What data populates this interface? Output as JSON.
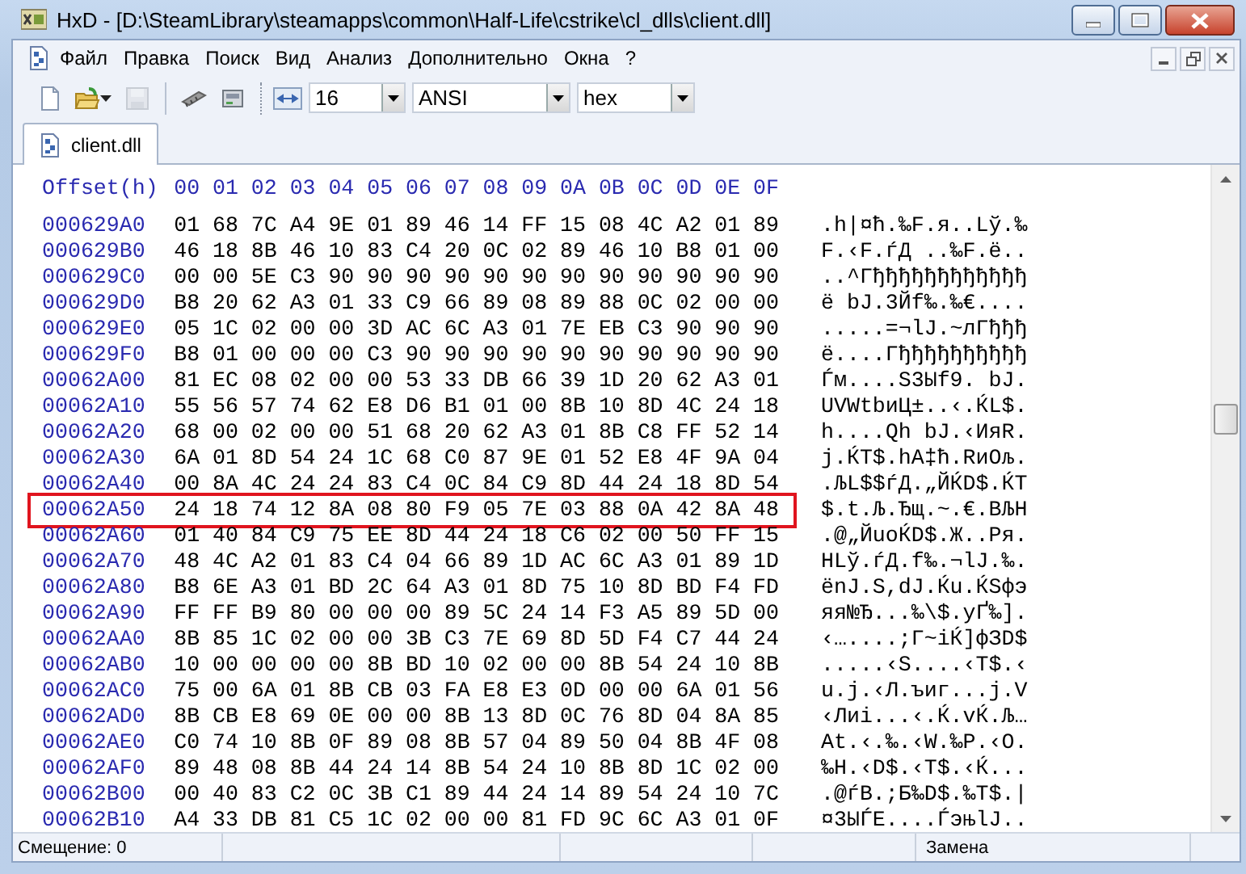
{
  "window": {
    "title": "HxD - [D:\\SteamLibrary\\steamapps\\common\\Half-Life\\cstrike\\cl_dlls\\client.dll]"
  },
  "menu": [
    {
      "label": "Файл"
    },
    {
      "label": "Правка"
    },
    {
      "label": "Поиск"
    },
    {
      "label": "Вид"
    },
    {
      "label": "Анализ"
    },
    {
      "label": "Дополнительно"
    },
    {
      "label": "Окна"
    },
    {
      "label": "?"
    }
  ],
  "toolbar": {
    "buttons": [
      {
        "kind": "new",
        "disabled": false
      },
      {
        "kind": "open",
        "disabled": false
      },
      {
        "kind": "save",
        "disabled": true
      },
      {
        "kind": "ram",
        "disabled": false
      },
      {
        "kind": "disk",
        "disabled": false
      }
    ],
    "bytes_per_row": "16",
    "charset": "ANSI",
    "offset_base": "hex"
  },
  "tabs": [
    {
      "label": "client.dll",
      "selected": true
    }
  ],
  "hex": {
    "header": {
      "offset": "Offset(h)",
      "columns": [
        "00",
        "01",
        "02",
        "03",
        "04",
        "05",
        "06",
        "07",
        "08",
        "09",
        "0A",
        "0B",
        "0C",
        "0D",
        "0E",
        "0F"
      ]
    },
    "rows": [
      {
        "offset": "000629A0",
        "bytes": [
          "01",
          "68",
          "7C",
          "A4",
          "9E",
          "01",
          "89",
          "46",
          "14",
          "FF",
          "15",
          "08",
          "4C",
          "A2",
          "01",
          "89"
        ],
        "text": ".h|¤ћ.‰F.я..Lў.‰",
        "highlighted": false
      },
      {
        "offset": "000629B0",
        "bytes": [
          "46",
          "18",
          "8B",
          "46",
          "10",
          "83",
          "C4",
          "20",
          "0C",
          "02",
          "89",
          "46",
          "10",
          "B8",
          "01",
          "00"
        ],
        "text": "F.‹F.ѓД ..‰F.ё..",
        "highlighted": false
      },
      {
        "offset": "000629C0",
        "bytes": [
          "00",
          "00",
          "5E",
          "C3",
          "90",
          "90",
          "90",
          "90",
          "90",
          "90",
          "90",
          "90",
          "90",
          "90",
          "90",
          "90"
        ],
        "text": "..^Гђђђђђђђђђђђђ",
        "highlighted": false
      },
      {
        "offset": "000629D0",
        "bytes": [
          "B8",
          "20",
          "62",
          "A3",
          "01",
          "33",
          "C9",
          "66",
          "89",
          "08",
          "89",
          "88",
          "0C",
          "02",
          "00",
          "00"
        ],
        "text": "ё bЈ.3Йf‰.‰€....",
        "highlighted": false
      },
      {
        "offset": "000629E0",
        "bytes": [
          "05",
          "1C",
          "02",
          "00",
          "00",
          "3D",
          "AC",
          "6C",
          "A3",
          "01",
          "7E",
          "EB",
          "C3",
          "90",
          "90",
          "90"
        ],
        "text": ".....=¬lЈ.~лГђђђ",
        "highlighted": false
      },
      {
        "offset": "000629F0",
        "bytes": [
          "B8",
          "01",
          "00",
          "00",
          "00",
          "C3",
          "90",
          "90",
          "90",
          "90",
          "90",
          "90",
          "90",
          "90",
          "90",
          "90"
        ],
        "text": "ё....Гђђђђђђђђђђ",
        "highlighted": false
      },
      {
        "offset": "00062A00",
        "bytes": [
          "81",
          "EC",
          "08",
          "02",
          "00",
          "00",
          "53",
          "33",
          "DB",
          "66",
          "39",
          "1D",
          "20",
          "62",
          "A3",
          "01"
        ],
        "text": "Ѓм....S3Ыf9. bЈ.",
        "highlighted": false
      },
      {
        "offset": "00062A10",
        "bytes": [
          "55",
          "56",
          "57",
          "74",
          "62",
          "E8",
          "D6",
          "B1",
          "01",
          "00",
          "8B",
          "10",
          "8D",
          "4C",
          "24",
          "18"
        ],
        "text": "UVWtbиЦ±..‹.ЌL$.",
        "highlighted": false
      },
      {
        "offset": "00062A20",
        "bytes": [
          "68",
          "00",
          "02",
          "00",
          "00",
          "51",
          "68",
          "20",
          "62",
          "A3",
          "01",
          "8B",
          "C8",
          "FF",
          "52",
          "14"
        ],
        "text": "h....Qh bЈ.‹ИяR.",
        "highlighted": false
      },
      {
        "offset": "00062A30",
        "bytes": [
          "6A",
          "01",
          "8D",
          "54",
          "24",
          "1C",
          "68",
          "C0",
          "87",
          "9E",
          "01",
          "52",
          "E8",
          "4F",
          "9A",
          "04"
        ],
        "text": "j.ЌT$.hА‡ћ.RиOљ.",
        "highlighted": false
      },
      {
        "offset": "00062A40",
        "bytes": [
          "00",
          "8A",
          "4C",
          "24",
          "24",
          "83",
          "C4",
          "0C",
          "84",
          "C9",
          "8D",
          "44",
          "24",
          "18",
          "8D",
          "54"
        ],
        "text": ".ЉL$$ѓД.„ЙЌD$.ЌT",
        "highlighted": false
      },
      {
        "offset": "00062A50",
        "bytes": [
          "24",
          "18",
          "74",
          "12",
          "8A",
          "08",
          "80",
          "F9",
          "05",
          "7E",
          "03",
          "88",
          "0A",
          "42",
          "8A",
          "48"
        ],
        "text": "$.t.Љ.Ђщ.~.€.BЉH",
        "highlighted": true
      },
      {
        "offset": "00062A60",
        "bytes": [
          "01",
          "40",
          "84",
          "C9",
          "75",
          "EE",
          "8D",
          "44",
          "24",
          "18",
          "C6",
          "02",
          "00",
          "50",
          "FF",
          "15"
        ],
        "text": ".@„ЙuоЌD$.Ж..Pя.",
        "highlighted": false
      },
      {
        "offset": "00062A70",
        "bytes": [
          "48",
          "4C",
          "A2",
          "01",
          "83",
          "C4",
          "04",
          "66",
          "89",
          "1D",
          "AC",
          "6C",
          "A3",
          "01",
          "89",
          "1D"
        ],
        "text": "HLў.ѓД.f‰.¬lЈ.‰.",
        "highlighted": false
      },
      {
        "offset": "00062A80",
        "bytes": [
          "B8",
          "6E",
          "A3",
          "01",
          "BD",
          "2C",
          "64",
          "A3",
          "01",
          "8D",
          "75",
          "10",
          "8D",
          "BD",
          "F4",
          "FD"
        ],
        "text": "ёnЈ.Ѕ,dЈ.Ќu.ЌЅфэ",
        "highlighted": false
      },
      {
        "offset": "00062A90",
        "bytes": [
          "FF",
          "FF",
          "B9",
          "80",
          "00",
          "00",
          "00",
          "89",
          "5C",
          "24",
          "14",
          "F3",
          "A5",
          "89",
          "5D",
          "00"
        ],
        "text": "яя№Ђ...‰\\$.уҐ‰].",
        "highlighted": false
      },
      {
        "offset": "00062AA0",
        "bytes": [
          "8B",
          "85",
          "1C",
          "02",
          "00",
          "00",
          "3B",
          "C3",
          "7E",
          "69",
          "8D",
          "5D",
          "F4",
          "C7",
          "44",
          "24"
        ],
        "text": "‹…....;Г~iЌ]фЗD$",
        "highlighted": false
      },
      {
        "offset": "00062AB0",
        "bytes": [
          "10",
          "00",
          "00",
          "00",
          "00",
          "8B",
          "BD",
          "10",
          "02",
          "00",
          "00",
          "8B",
          "54",
          "24",
          "10",
          "8B"
        ],
        "text": ".....‹Ѕ....‹T$.‹",
        "highlighted": false
      },
      {
        "offset": "00062AC0",
        "bytes": [
          "75",
          "00",
          "6A",
          "01",
          "8B",
          "CB",
          "03",
          "FA",
          "E8",
          "E3",
          "0D",
          "00",
          "00",
          "6A",
          "01",
          "56"
        ],
        "text": "u.j.‹Л.ъиг...j.V",
        "highlighted": false
      },
      {
        "offset": "00062AD0",
        "bytes": [
          "8B",
          "CB",
          "E8",
          "69",
          "0E",
          "00",
          "00",
          "8B",
          "13",
          "8D",
          "0C",
          "76",
          "8D",
          "04",
          "8A",
          "85"
        ],
        "text": "‹Лиi...‹.Ќ.vЌ.Љ…",
        "highlighted": false
      },
      {
        "offset": "00062AE0",
        "bytes": [
          "C0",
          "74",
          "10",
          "8B",
          "0F",
          "89",
          "08",
          "8B",
          "57",
          "04",
          "89",
          "50",
          "04",
          "8B",
          "4F",
          "08"
        ],
        "text": "Аt.‹.‰.‹W.‰P.‹O.",
        "highlighted": false
      },
      {
        "offset": "00062AF0",
        "bytes": [
          "89",
          "48",
          "08",
          "8B",
          "44",
          "24",
          "14",
          "8B",
          "54",
          "24",
          "10",
          "8B",
          "8D",
          "1C",
          "02",
          "00"
        ],
        "text": "‰H.‹D$.‹T$.‹Ќ...",
        "highlighted": false
      },
      {
        "offset": "00062B00",
        "bytes": [
          "00",
          "40",
          "83",
          "C2",
          "0C",
          "3B",
          "C1",
          "89",
          "44",
          "24",
          "14",
          "89",
          "54",
          "24",
          "10",
          "7C"
        ],
        "text": ".@ѓВ.;Б‰D$.‰T$.|",
        "highlighted": false
      },
      {
        "offset": "00062B10",
        "bytes": [
          "A4",
          "33",
          "DB",
          "81",
          "C5",
          "1C",
          "02",
          "00",
          "00",
          "81",
          "FD",
          "9C",
          "6C",
          "A3",
          "01",
          "0F"
        ],
        "text": "¤3ЫЃЕ....ЃэњlЈ..",
        "highlighted": false
      }
    ]
  },
  "status_bar": {
    "offset": "Смещение: 0",
    "mode": "Замена"
  }
}
